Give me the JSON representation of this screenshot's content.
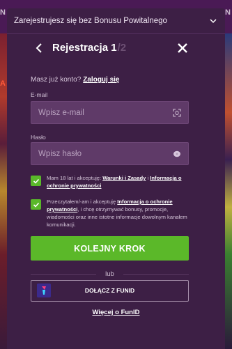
{
  "background": {
    "left_fragment": "N",
    "right_fragment": "N",
    "left_fragment_2": "A"
  },
  "banner": {
    "text": "Zarejestrujesz się bez Bonusu Powitalnego",
    "icon": "chevron-down-icon"
  },
  "header": {
    "title": "Rejestracja 1",
    "title_ghost": "/2",
    "back_icon": "back-arrow-icon",
    "close_icon": "close-icon"
  },
  "login": {
    "prompt": "Masz już konto?",
    "link": "Zaloguj się"
  },
  "form": {
    "email_label": "E-mail",
    "email_placeholder": "Wpisz e-mail",
    "email_value": "",
    "password_label": "Hasło",
    "password_placeholder": "Wpisz hasło",
    "password_value": ""
  },
  "consents": [
    {
      "checked": true,
      "text_before": "Mam 18 lat i akceptuję: ",
      "link1": "Warunki i Zasady",
      "between": " i ",
      "link2": "Informacja o ochronie prywatności"
    },
    {
      "checked": true,
      "text_before": "Przeczytałem/-am i akceptuję ",
      "link1": "Informacja o ochronie prywatności",
      "text_after": ", i chcę otrzymywać bonusy, promocje, wiadomości oraz inne istotne informacje dowolnym kanałem komunikacji."
    }
  ],
  "cta": {
    "label": "KOLEJNY KROK"
  },
  "divider": {
    "label": "lub"
  },
  "funid": {
    "label": "DOŁĄCZ Z FUNID",
    "more_link": "Więcej o FunID"
  },
  "colors": {
    "panel": "#3d1f45",
    "field": "#5f3a68",
    "accent_green": "#5bb829",
    "text_primary": "#ffffff"
  }
}
